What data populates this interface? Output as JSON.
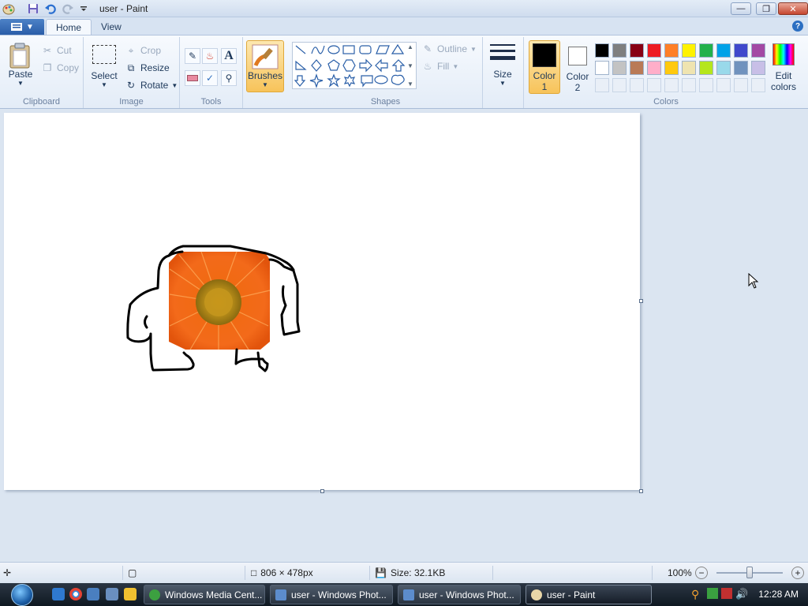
{
  "window": {
    "title": "user - Paint"
  },
  "tabs": {
    "home": "Home",
    "view": "View"
  },
  "clipboard": {
    "paste": "Paste",
    "cut": "Cut",
    "copy": "Copy",
    "label": "Clipboard"
  },
  "image": {
    "select": "Select",
    "crop": "Crop",
    "resize": "Resize",
    "rotate": "Rotate",
    "label": "Image"
  },
  "tools": {
    "label": "Tools"
  },
  "brushes": {
    "label": "Brushes"
  },
  "shapes": {
    "outline": "Outline",
    "fill": "Fill",
    "label": "Shapes"
  },
  "size": {
    "label": "Size"
  },
  "colors": {
    "color1_line1": "Color",
    "color1_line2": "1",
    "color2_line1": "Color",
    "color2_line2": "2",
    "edit_line1": "Edit",
    "edit_line2": "colors",
    "label": "Colors",
    "color1_value": "#000000",
    "color2_value": "#ffffff",
    "palette_row1": [
      "#000000",
      "#7f7f7f",
      "#880015",
      "#ed1c24",
      "#ff7f27",
      "#fff200",
      "#22b14c",
      "#00a2e8",
      "#3f48cc",
      "#a349a4"
    ],
    "palette_row2": [
      "#ffffff",
      "#c3c3c3",
      "#b97a57",
      "#ffaec9",
      "#ffc90e",
      "#efe4b0",
      "#b5e61d",
      "#99d9ea",
      "#7092be",
      "#c8bfe7"
    ]
  },
  "status": {
    "dimensions": "806 × 478px",
    "size": "Size: 32.1KB",
    "zoom": "100%"
  },
  "taskbar": {
    "items": [
      "Windows Media Cent...",
      "user - Windows Phot...",
      "user - Windows Phot...",
      "user - Paint"
    ],
    "clock": "12:28 AM"
  }
}
